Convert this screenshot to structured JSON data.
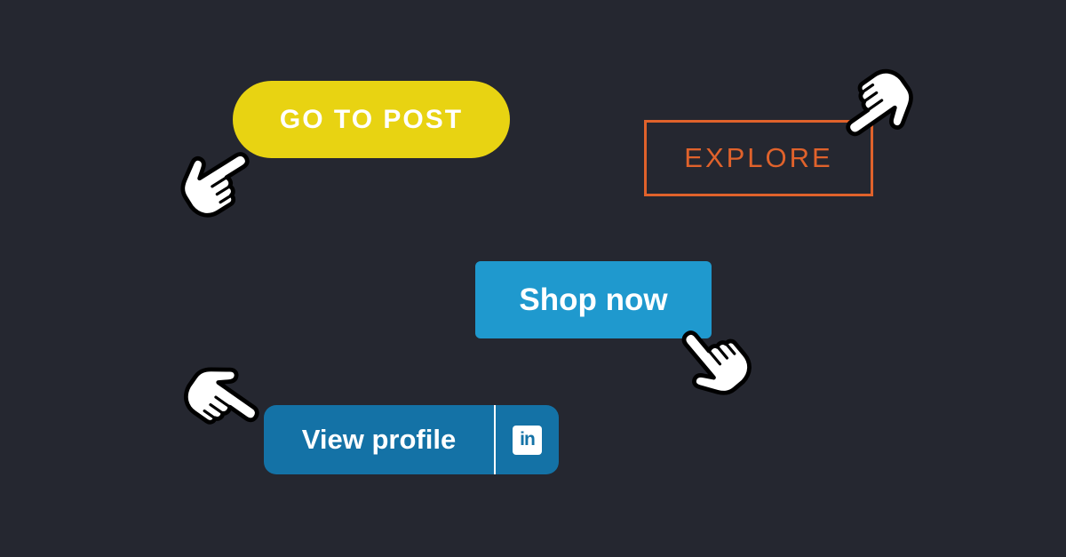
{
  "colors": {
    "background": "#252730",
    "go_to_post_bg": "#e8d312",
    "go_to_post_text": "#ffffff",
    "explore_border": "#e0622b",
    "explore_text": "#e0622b",
    "shop_now_bg": "#1f99ce",
    "shop_now_text": "#ffffff",
    "view_profile_bg": "#1472a6",
    "view_profile_text": "#ffffff",
    "divider": "#ffffff",
    "linkedin_icon_bg": "#ffffff",
    "linkedin_icon_fg": "#1472a6",
    "hand_fill": "#ffffff",
    "hand_outline": "#000000"
  },
  "buttons": {
    "go_to_post": {
      "label": "GO TO POST"
    },
    "explore": {
      "label": "EXPLORE"
    },
    "shop_now": {
      "label": "Shop now"
    },
    "view_profile": {
      "label": "View profile",
      "icon": "linkedin-icon",
      "icon_text": "in"
    }
  },
  "cursors": [
    {
      "name": "hand-pointer-icon-go-to-post"
    },
    {
      "name": "hand-pointer-icon-explore"
    },
    {
      "name": "hand-pointer-icon-shop-now"
    },
    {
      "name": "hand-pointer-icon-view-profile"
    }
  ]
}
